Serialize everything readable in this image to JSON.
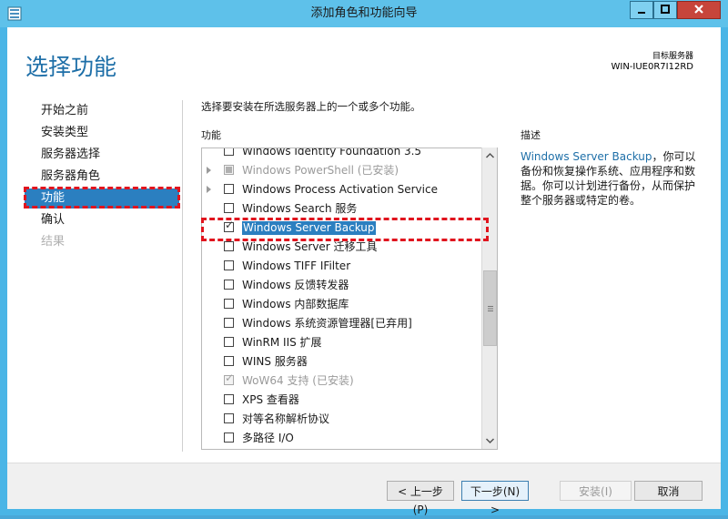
{
  "window": {
    "title": "添加角色和功能向导"
  },
  "header": {
    "page_title": "选择功能",
    "target_label": "目标服务器",
    "target_name": "WIN-IUE0R7I12RD"
  },
  "nav": {
    "items": [
      {
        "label": "开始之前",
        "state": "normal"
      },
      {
        "label": "安装类型",
        "state": "normal"
      },
      {
        "label": "服务器选择",
        "state": "normal"
      },
      {
        "label": "服务器角色",
        "state": "normal"
      },
      {
        "label": "功能",
        "state": "active"
      },
      {
        "label": "确认",
        "state": "normal"
      },
      {
        "label": "结果",
        "state": "disabled"
      }
    ]
  },
  "main": {
    "instruction": "选择要安装在所选服务器上的一个或多个功能。",
    "features_label": "功能",
    "features": [
      {
        "label": "Windows Identity Foundation 3.5",
        "checkbox": "none",
        "expander": false
      },
      {
        "label": "Windows PowerShell (已安装)",
        "checkbox": "partial-disabled",
        "expander": true
      },
      {
        "label": "Windows Process Activation Service",
        "checkbox": "unchecked",
        "expander": true
      },
      {
        "label": "Windows Search 服务",
        "checkbox": "unchecked",
        "expander": false
      },
      {
        "label": "Windows Server Backup",
        "checkbox": "checked",
        "expander": false,
        "selected": true
      },
      {
        "label": "Windows Server 迁移工具",
        "checkbox": "unchecked",
        "expander": false
      },
      {
        "label": "Windows TIFF IFilter",
        "checkbox": "unchecked",
        "expander": false
      },
      {
        "label": "Windows 反馈转发器",
        "checkbox": "unchecked",
        "expander": false
      },
      {
        "label": "Windows 内部数据库",
        "checkbox": "unchecked",
        "expander": false
      },
      {
        "label": "Windows 系统资源管理器[已弃用]",
        "checkbox": "unchecked",
        "expander": false
      },
      {
        "label": "WinRM IIS 扩展",
        "checkbox": "unchecked",
        "expander": false
      },
      {
        "label": "WINS 服务器",
        "checkbox": "unchecked",
        "expander": false
      },
      {
        "label": "WoW64 支持 (已安装)",
        "checkbox": "checked-disabled",
        "expander": false
      },
      {
        "label": "XPS 查看器",
        "checkbox": "unchecked",
        "expander": false
      },
      {
        "label": "对等名称解析协议",
        "checkbox": "unchecked",
        "expander": false
      },
      {
        "label": "多路径 I/O",
        "checkbox": "unchecked",
        "expander": false
      }
    ]
  },
  "description": {
    "label": "描述",
    "link_text": "Windows Server Backup",
    "text": "，你可以备份和恢复操作系统、应用程序和数据。你可以计划进行备份，从而保护整个服务器或特定的卷。"
  },
  "footer": {
    "prev_label": "< 上一步(P)",
    "next_label": "下一步(N) >",
    "install_label": "安装(I)",
    "cancel_label": "取消"
  },
  "colors": {
    "accent": "#2b7fc0",
    "title_blue": "#1e6fa8",
    "window_frame": "#4ab5e6",
    "highlight_red": "#e0141e"
  }
}
